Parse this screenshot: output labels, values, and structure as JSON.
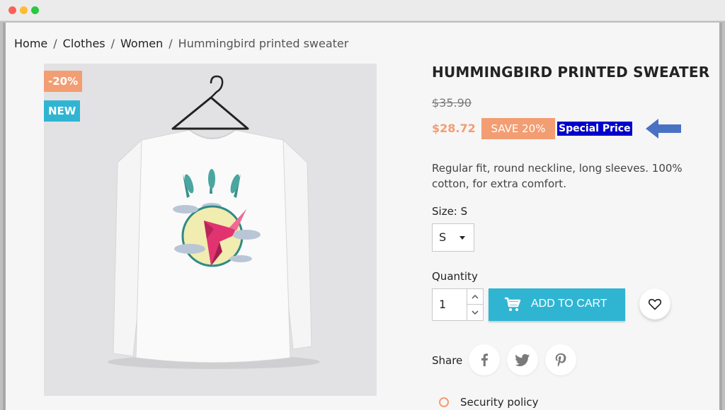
{
  "breadcrumb": {
    "items": [
      "Home",
      "Clothes",
      "Women"
    ],
    "separator": "/",
    "current": "Hummingbird printed sweater"
  },
  "product": {
    "image_alt": "white long-sleeve sweater with hummingbird print on hanger",
    "flags": {
      "discount": "-20%",
      "new": "NEW"
    },
    "title": "HUMMINGBIRD PRINTED SWEATER",
    "regular_price": "$35.90",
    "price": "$28.72",
    "save_badge": "SAVE 20%",
    "special_label": "Special Price",
    "description": "Regular fit, round neckline, long sleeves. 100% cotton, for extra comfort."
  },
  "size": {
    "label": "Size: S",
    "selected": "S"
  },
  "quantity": {
    "label": "Quantity",
    "value": "1"
  },
  "cart": {
    "label": "ADD TO CART"
  },
  "share": {
    "label": "Share",
    "icons": [
      "facebook-icon",
      "twitter-icon",
      "pinterest-icon"
    ]
  },
  "security": {
    "label": "Security policy"
  },
  "colors": {
    "accent": "#2fb5d2",
    "discount": "#f39d72",
    "highlight": "#0000cc",
    "arrow": "#4a72c4"
  }
}
